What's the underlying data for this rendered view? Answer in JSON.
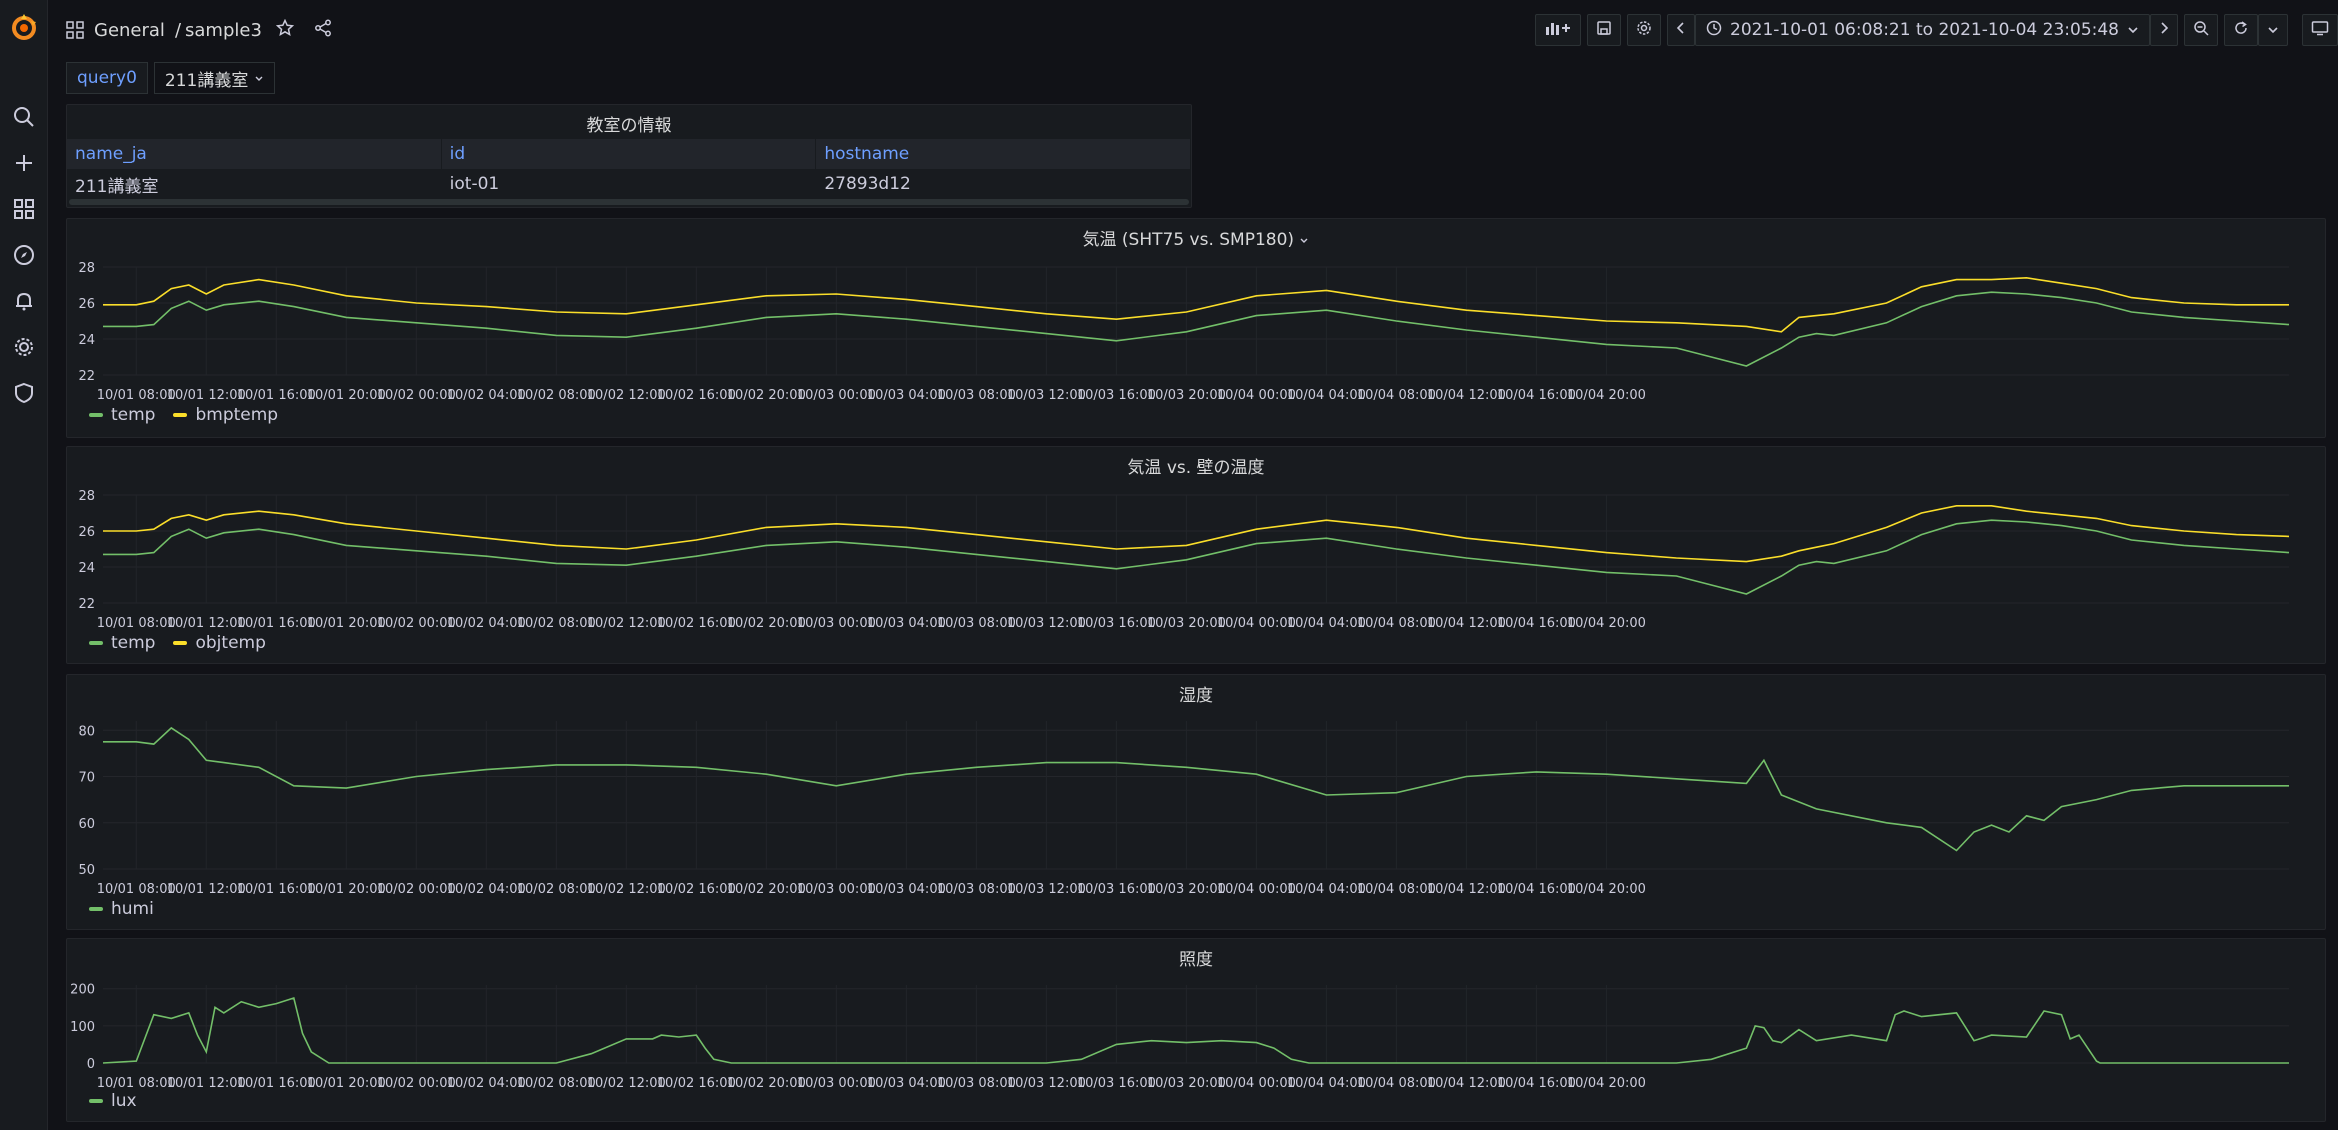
{
  "breadcrumb": {
    "folder": "General",
    "separator": "/",
    "dashboard": "sample3"
  },
  "timerange": {
    "label": "2021-10-01 06:08:21 to 2021-10-04 23:05:48"
  },
  "variables": {
    "label": "query0",
    "value": "211講義室"
  },
  "info_table": {
    "title": "教室の情報",
    "headers": [
      "name_ja",
      "id",
      "hostname"
    ],
    "row": [
      "211講義室",
      "iot-01",
      "27893d12"
    ]
  },
  "icons": [
    "grafana-logo-icon",
    "search-icon",
    "plus-icon",
    "dashboards-icon",
    "explore-icon",
    "alert-bell-icon",
    "gear-icon",
    "shield-icon",
    "star-icon",
    "share-icon",
    "add-panel-icon",
    "save-icon",
    "settings-icon",
    "chevron-left-icon",
    "clock-icon",
    "chevron-down-icon",
    "chevron-right-icon",
    "zoom-out-icon",
    "refresh-icon",
    "tv-icon"
  ],
  "colors": {
    "green": "#73bf69",
    "yellow": "#fade2a",
    "bg": "#111217",
    "panel": "#181b1f",
    "accent": "#6e9fff"
  },
  "x_ticks": [
    "10/01 08:00",
    "10/01 12:00",
    "10/01 16:00",
    "10/01 20:00",
    "10/02 00:00",
    "10/02 04:00",
    "10/02 08:00",
    "10/02 12:00",
    "10/02 16:00",
    "10/02 20:00",
    "10/03 00:00",
    "10/03 04:00",
    "10/03 08:00",
    "10/03 12:00",
    "10/03 16:00",
    "10/03 20:00",
    "10/04 00:00",
    "10/04 04:00",
    "10/04 08:00",
    "10/04 12:00",
    "10/04 16:00",
    "10/04 20:00"
  ],
  "chart_data": [
    {
      "type": "line",
      "title": "気温 (SHT75 vs. SMP180)",
      "x_unit": "hours since 10/01 00:00",
      "ylim": [
        22,
        28
      ],
      "yticks": [
        "28",
        "26",
        "24",
        "22"
      ],
      "series": [
        {
          "name": "temp",
          "color": "#73bf69",
          "x": [
            6.1,
            8,
            9,
            10,
            11,
            12,
            13,
            15,
            17,
            20,
            24,
            28,
            32,
            36,
            40,
            44,
            48,
            52,
            56,
            60,
            64,
            68,
            72,
            76,
            80,
            84,
            88,
            92,
            96,
            100,
            102,
            103,
            104,
            105,
            108,
            110,
            112,
            114,
            116,
            118,
            120,
            122,
            125,
            128,
            131
          ],
          "y": [
            24.7,
            24.7,
            24.8,
            25.7,
            26.1,
            25.6,
            25.9,
            26.1,
            25.8,
            25.2,
            24.9,
            24.6,
            24.2,
            24.1,
            24.6,
            25.2,
            25.4,
            25.1,
            24.7,
            24.3,
            23.9,
            24.4,
            25.3,
            25.6,
            25.0,
            24.5,
            24.1,
            23.7,
            23.5,
            22.5,
            23.5,
            24.1,
            24.3,
            24.2,
            24.9,
            25.8,
            26.4,
            26.6,
            26.5,
            26.3,
            26.0,
            25.5,
            25.2,
            25.0,
            24.8
          ]
        },
        {
          "name": "bmptemp",
          "color": "#fade2a",
          "x": [
            6.1,
            8,
            9,
            10,
            11,
            12,
            13,
            15,
            17,
            20,
            24,
            28,
            32,
            36,
            40,
            44,
            48,
            52,
            56,
            60,
            64,
            68,
            72,
            76,
            80,
            84,
            88,
            92,
            96,
            100,
            102,
            103,
            104,
            105,
            108,
            110,
            112,
            114,
            116,
            118,
            120,
            122,
            125,
            128,
            131
          ],
          "y": [
            25.9,
            25.9,
            26.1,
            26.8,
            27.0,
            26.5,
            27.0,
            27.3,
            27.0,
            26.4,
            26.0,
            25.8,
            25.5,
            25.4,
            25.9,
            26.4,
            26.5,
            26.2,
            25.8,
            25.4,
            25.1,
            25.5,
            26.4,
            26.7,
            26.1,
            25.6,
            25.3,
            25.0,
            24.9,
            24.7,
            24.4,
            25.2,
            25.3,
            25.4,
            26.0,
            26.9,
            27.3,
            27.3,
            27.4,
            27.1,
            26.8,
            26.3,
            26.0,
            25.9,
            25.9
          ]
        }
      ]
    },
    {
      "type": "line",
      "title": "気温 vs. 壁の温度",
      "x_unit": "hours since 10/01 00:00",
      "ylim": [
        22,
        28
      ],
      "yticks": [
        "28",
        "26",
        "24",
        "22"
      ],
      "series": [
        {
          "name": "temp",
          "color": "#73bf69",
          "x": [
            6.1,
            8,
            9,
            10,
            11,
            12,
            13,
            15,
            17,
            20,
            24,
            28,
            32,
            36,
            40,
            44,
            48,
            52,
            56,
            60,
            64,
            68,
            72,
            76,
            80,
            84,
            88,
            92,
            96,
            100,
            102,
            103,
            104,
            105,
            108,
            110,
            112,
            114,
            116,
            118,
            120,
            122,
            125,
            128,
            131
          ],
          "y": [
            24.7,
            24.7,
            24.8,
            25.7,
            26.1,
            25.6,
            25.9,
            26.1,
            25.8,
            25.2,
            24.9,
            24.6,
            24.2,
            24.1,
            24.6,
            25.2,
            25.4,
            25.1,
            24.7,
            24.3,
            23.9,
            24.4,
            25.3,
            25.6,
            25.0,
            24.5,
            24.1,
            23.7,
            23.5,
            22.5,
            23.5,
            24.1,
            24.3,
            24.2,
            24.9,
            25.8,
            26.4,
            26.6,
            26.5,
            26.3,
            26.0,
            25.5,
            25.2,
            25.0,
            24.8
          ]
        },
        {
          "name": "objtemp",
          "color": "#fade2a",
          "x": [
            6.1,
            8,
            9,
            10,
            11,
            12,
            13,
            15,
            17,
            20,
            24,
            28,
            32,
            36,
            40,
            44,
            48,
            52,
            56,
            60,
            64,
            68,
            72,
            76,
            80,
            84,
            88,
            92,
            96,
            100,
            102,
            103,
            104,
            105,
            108,
            110,
            112,
            114,
            116,
            118,
            120,
            122,
            125,
            128,
            131
          ],
          "y": [
            26.0,
            26.0,
            26.1,
            26.7,
            26.9,
            26.6,
            26.9,
            27.1,
            26.9,
            26.4,
            26.0,
            25.6,
            25.2,
            25.0,
            25.5,
            26.2,
            26.4,
            26.2,
            25.8,
            25.4,
            25.0,
            25.2,
            26.1,
            26.6,
            26.2,
            25.6,
            25.2,
            24.8,
            24.5,
            24.3,
            24.6,
            24.9,
            25.1,
            25.3,
            26.2,
            27.0,
            27.4,
            27.4,
            27.1,
            26.9,
            26.7,
            26.3,
            26.0,
            25.8,
            25.7
          ]
        }
      ]
    },
    {
      "type": "line",
      "title": "湿度",
      "x_unit": "hours since 10/01 00:00",
      "ylim": [
        50,
        82
      ],
      "yticks": [
        "80",
        "70",
        "60",
        "50"
      ],
      "series": [
        {
          "name": "humi",
          "color": "#73bf69",
          "x": [
            6.1,
            8,
            9,
            10,
            11,
            12,
            13,
            15,
            17,
            20,
            24,
            28,
            32,
            36,
            40,
            44,
            48,
            52,
            56,
            60,
            64,
            68,
            72,
            76,
            80,
            84,
            88,
            92,
            96,
            100,
            101,
            102,
            104,
            108,
            110,
            112,
            113,
            114,
            115,
            116,
            117,
            118,
            120,
            122,
            125,
            128,
            131
          ],
          "y": [
            77.5,
            77.5,
            77.0,
            80.5,
            78.0,
            73.5,
            73.0,
            72.0,
            68.0,
            67.5,
            70.0,
            71.5,
            72.5,
            72.5,
            72.0,
            70.5,
            68.0,
            70.5,
            72.0,
            73.0,
            73.0,
            72.0,
            70.5,
            66.0,
            66.5,
            70.0,
            71.0,
            70.5,
            69.5,
            68.5,
            73.5,
            66.0,
            63.0,
            60.0,
            59.0,
            54.0,
            58.0,
            59.5,
            58.0,
            61.5,
            60.5,
            63.5,
            65.0,
            67.0,
            68.0,
            68.0,
            68.0
          ]
        }
      ]
    },
    {
      "type": "line",
      "title": "照度",
      "x_unit": "hours since 10/01 00:00",
      "ylim": [
        0,
        210
      ],
      "yticks": [
        "200",
        "100",
        "0"
      ],
      "series": [
        {
          "name": "lux",
          "color": "#73bf69",
          "x": [
            6.1,
            8,
            9,
            10,
            11,
            11.5,
            12,
            12.5,
            13,
            14,
            15,
            16,
            17,
            17.5,
            18,
            19,
            20,
            24,
            28,
            30,
            32,
            34,
            36,
            37.5,
            38,
            39,
            40,
            40.5,
            41,
            42,
            44,
            48,
            52,
            56,
            58,
            60,
            62,
            64,
            66,
            68,
            70,
            72,
            73,
            74,
            75,
            76,
            78,
            80,
            84,
            88,
            92,
            96,
            98,
            100,
            100.5,
            101,
            101.5,
            102,
            103,
            104,
            106,
            108,
            108.5,
            109,
            110,
            112,
            113,
            114,
            116,
            117,
            118,
            118.5,
            119,
            120,
            120.2,
            121,
            124,
            128,
            131
          ],
          "y": [
            0,
            5,
            130,
            120,
            135,
            75,
            30,
            150,
            135,
            165,
            150,
            160,
            175,
            80,
            30,
            0,
            0,
            0,
            0,
            0,
            0,
            25,
            65,
            65,
            75,
            70,
            75,
            40,
            10,
            0,
            0,
            0,
            0,
            0,
            0,
            0,
            10,
            50,
            60,
            55,
            60,
            55,
            40,
            10,
            0,
            0,
            0,
            0,
            0,
            0,
            0,
            0,
            10,
            40,
            100,
            95,
            60,
            55,
            90,
            60,
            75,
            60,
            130,
            140,
            125,
            135,
            60,
            75,
            70,
            140,
            130,
            65,
            75,
            5,
            0,
            0,
            0,
            0,
            0
          ]
        }
      ]
    }
  ]
}
